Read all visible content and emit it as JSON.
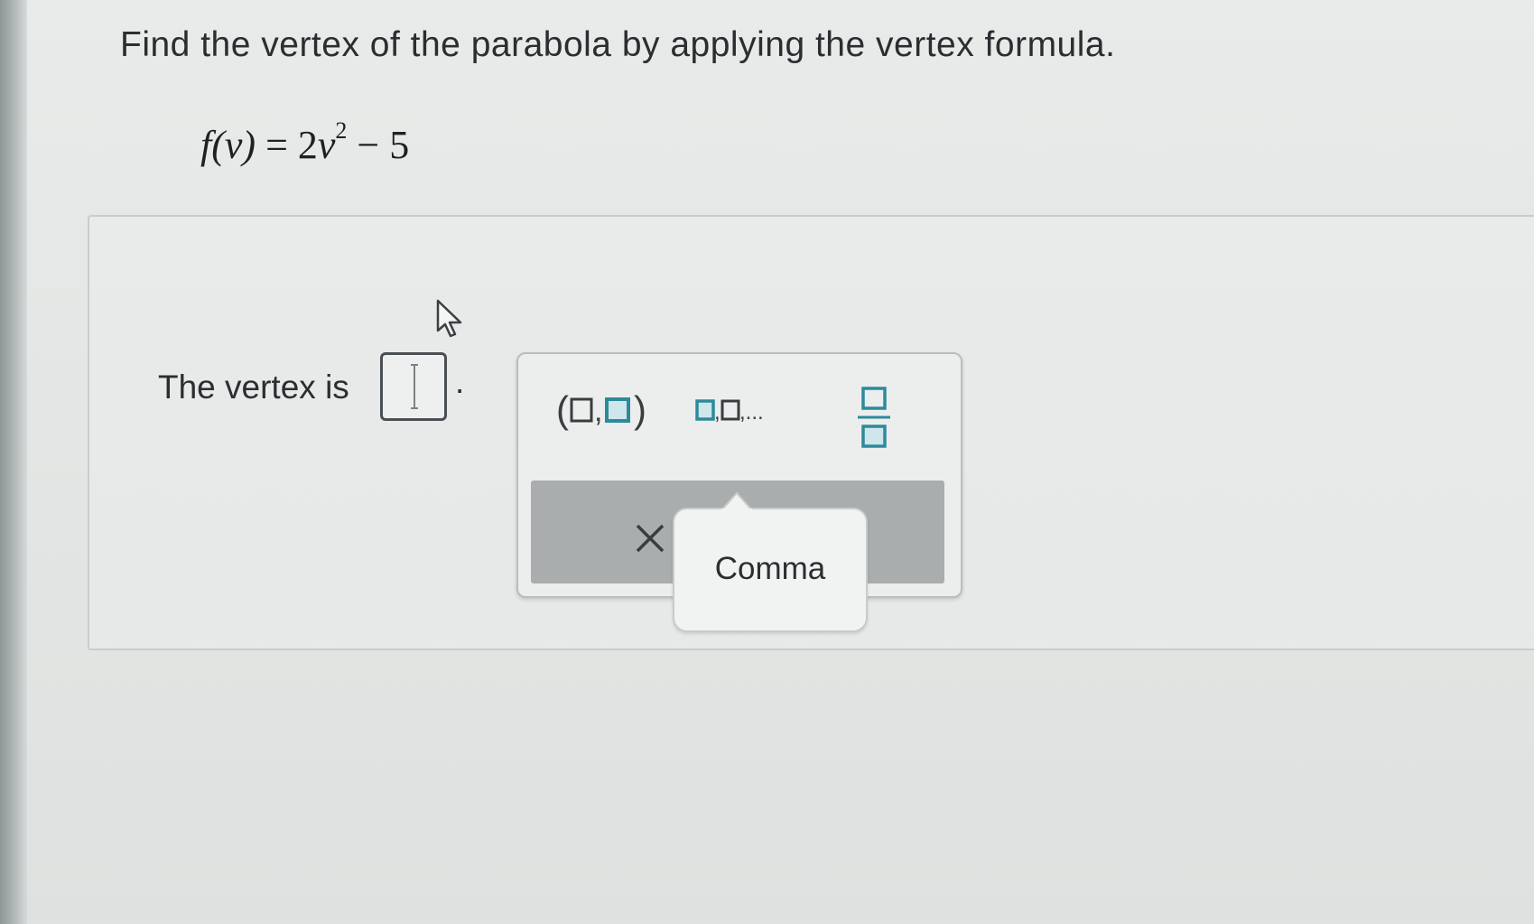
{
  "question": {
    "prompt": "Find the vertex of the parabola by applying the vertex formula."
  },
  "formula": {
    "lhs": "f(v)",
    "equals": "=",
    "coefficient": "2",
    "variable": "v",
    "exponent": "2",
    "rest": " − 5"
  },
  "answer": {
    "label": "The vertex is",
    "trailing_punctuation": ".",
    "input_value": ""
  },
  "palette": {
    "ordered_pair_open": "(",
    "ordered_pair_comma": ",",
    "ordered_pair_close": ")",
    "list_label": ",...",
    "clear_icon": "close-x-icon",
    "fraction_icon": "fraction-icon",
    "accent_color": "#2d8a9b"
  },
  "tooltip": {
    "text": "Comma"
  }
}
